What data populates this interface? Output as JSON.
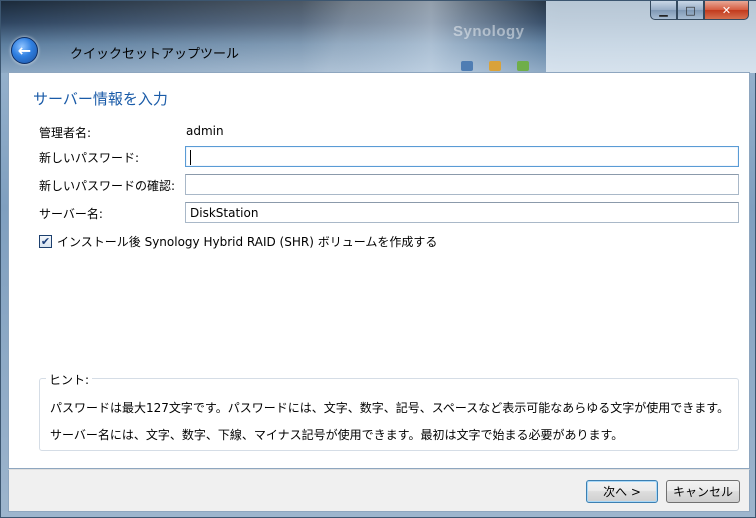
{
  "window": {
    "title": "クイックセットアップツール",
    "brand_watermark": "Synology",
    "caption": {
      "minimize_glyph": "▁",
      "maximize_glyph": "□",
      "close_glyph": "✕"
    }
  },
  "header": {
    "back_glyph": "←"
  },
  "page": {
    "heading": "サーバー情報を入力"
  },
  "form": {
    "admin_label": "管理者名:",
    "admin_value": "admin",
    "new_password_label": "新しいパスワード:",
    "new_password_value": "",
    "confirm_password_label": "新しいパスワードの確認:",
    "confirm_password_value": "",
    "server_name_label": "サーバー名:",
    "server_name_value": "DiskStation",
    "shr_checkbox_label": "インストール後 Synology Hybrid RAID (SHR) ボリュームを作成する",
    "shr_checked": true,
    "check_glyph": "✔"
  },
  "hint": {
    "title": "ヒント:",
    "line1": "パスワードは最大127文字です。パスワードには、文字、数字、記号、スペースなど表示可能なあらゆる文字が使用できます。",
    "line2": "サーバー名には、文字、数字、下線、マイナス記号が使用できます。最初は文字で始まる必要があります。"
  },
  "footer": {
    "next_label": "次へ >",
    "cancel_label": "キャンセル"
  },
  "colors": {
    "heading": "#1a5ba8",
    "focus_border": "#5a9bd5",
    "close_button": "#c23a1d"
  }
}
